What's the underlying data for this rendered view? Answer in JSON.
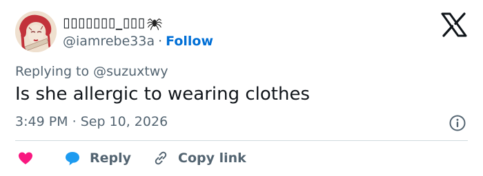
{
  "author": {
    "display_name": "▯▯▯▯▯▯▯_▯▯▯",
    "handle": "@iamrebe33a",
    "separator": "·",
    "follow_label": "Follow"
  },
  "tweet": {
    "replying_prefix": "Replying to ",
    "replying_to": "@suzuxtwy",
    "text": "Is she allergic to wearing clothes",
    "time": "3:49 PM",
    "date_separator": "·",
    "date": "Sep 10, 2026"
  },
  "actions": {
    "reply_label": "Reply",
    "copy_link_label": "Copy link"
  },
  "icons": {
    "avatar": "avatar-illustration",
    "badge": "spider-icon",
    "platform": "x-logo-icon",
    "info": "info-icon",
    "like": "heart-icon",
    "reply": "reply-bubble-icon",
    "copy": "link-icon"
  },
  "colors": {
    "follow": "#006fd6",
    "muted": "#536471",
    "heart": "#f91880",
    "reply": "#1d9bf0"
  }
}
